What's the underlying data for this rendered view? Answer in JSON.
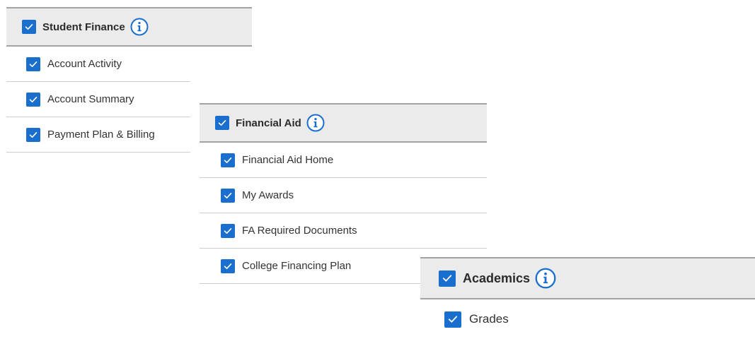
{
  "colors": {
    "checkbox": "#1a6fce",
    "header_bg": "#ebebeb",
    "header_border": "#a3a3a3",
    "info_icon": "#1a6fce"
  },
  "icons": {
    "checkbox": "check-icon",
    "info": "info-circle-icon"
  },
  "student_finance": {
    "title": "Student Finance",
    "checked": true,
    "items": [
      {
        "label": "Account Activity",
        "checked": true
      },
      {
        "label": "Account Summary",
        "checked": true
      },
      {
        "label": "Payment Plan & Billing",
        "checked": true
      }
    ]
  },
  "financial_aid": {
    "title": "Financial Aid",
    "checked": true,
    "items": [
      {
        "label": "Financial Aid Home",
        "checked": true
      },
      {
        "label": "My Awards",
        "checked": true
      },
      {
        "label": "FA Required Documents",
        "checked": true
      },
      {
        "label": "College Financing Plan",
        "checked": true
      }
    ]
  },
  "academics": {
    "title": "Academics",
    "checked": true,
    "items": [
      {
        "label": "Grades",
        "checked": true
      }
    ]
  }
}
